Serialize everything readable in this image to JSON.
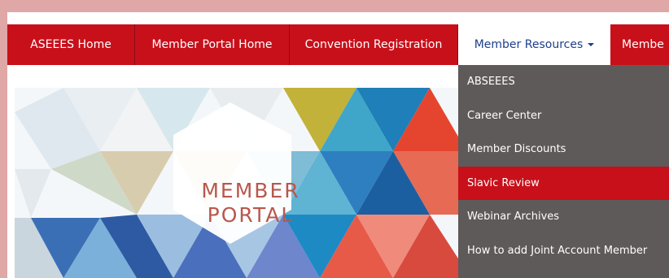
{
  "navbar": {
    "items": [
      {
        "label": "ASEEES Home"
      },
      {
        "label": "Member Portal Home"
      },
      {
        "label": "Convention Registration"
      },
      {
        "label": "Member Resources"
      },
      {
        "label": "Membe"
      }
    ]
  },
  "hero": {
    "line1": "MEMBER",
    "line2": "PORTAL"
  },
  "dropdown": {
    "items": [
      {
        "label": "ABSEEES"
      },
      {
        "label": "Career Center"
      },
      {
        "label": "Member Discounts"
      },
      {
        "label": "Slavic Review"
      },
      {
        "label": "Webinar Archives"
      },
      {
        "label": "How to add Joint Account Member"
      }
    ]
  },
  "colors": {
    "background": "#e0a7a7",
    "nav_red": "#c8101a",
    "active_text": "#1d3f8c",
    "dropdown_bg": "#5f5a5a",
    "hero_text": "#b9574c"
  }
}
